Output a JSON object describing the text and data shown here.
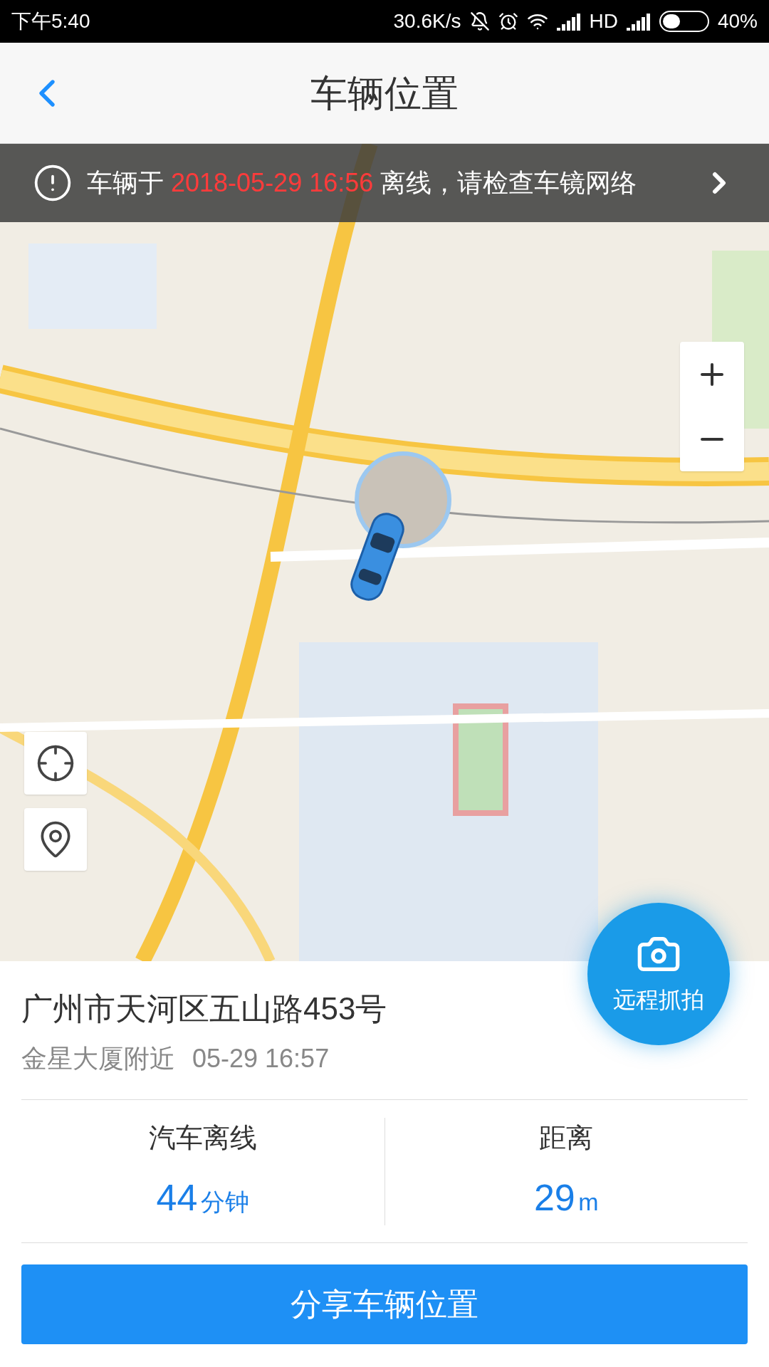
{
  "status_bar": {
    "time": "下午5:40",
    "speed": "30.6K/s",
    "network": "HD",
    "battery": "40%"
  },
  "header": {
    "title": "车辆位置"
  },
  "banner": {
    "prefix": "车辆于 ",
    "time": "2018-05-29 16:56",
    "suffix": " 离线，请检查车镜网络"
  },
  "address": {
    "line": "广州市天河区五山路453号",
    "nearby": "金星大厦附近",
    "time": "05-29 16:57"
  },
  "camera_button": {
    "label": "远程抓拍"
  },
  "stats": [
    {
      "label": "汽车离线",
      "value": "44",
      "unit": "分钟"
    },
    {
      "label": "距离",
      "value": "29",
      "unit": "m"
    }
  ],
  "share_button": {
    "label": "分享车辆位置"
  }
}
